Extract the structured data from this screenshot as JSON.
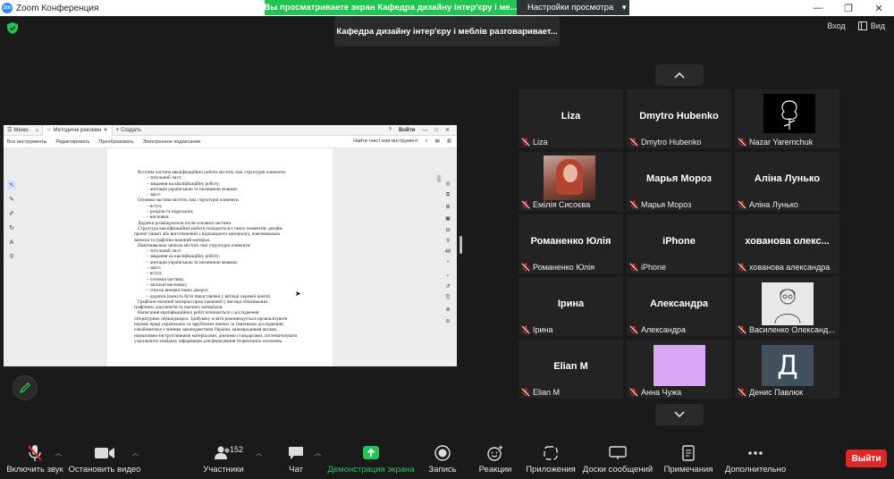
{
  "window": {
    "app_icon_text": "zm",
    "title": "Zoom Конференция",
    "controls": [
      "—",
      "❐",
      "✕"
    ]
  },
  "share_banner": {
    "text": "Вы просматриваете экран Кафедра дизайну інтер'єру і ме...",
    "view_settings": "Настройки просмотра"
  },
  "speaker_tip": "Кафедра дизайну інтер'єру і меблів разговаривает...",
  "top_right": {
    "enter_label": "Вход",
    "view_label": "Вид"
  },
  "shared_doc": {
    "tabs": [
      "Меню",
      "Методичні рекомен",
      "Создать"
    ],
    "login_label": "Войти",
    "menu_items": [
      "Все инструменты",
      "Редактировать",
      "Преобразовать",
      "Электронное подписание"
    ],
    "search_label": "Найти текст или инструмент",
    "page_number": "9",
    "page_total": "46",
    "lines": [
      {
        "text": "Вступна частина кваліфікаційної роботи містить такі структурні елементи:",
        "indent": 0
      },
      {
        "text": "–    титульний лист;",
        "indent": 1
      },
      {
        "text": "–    завдання на кваліфікаційну роботу;",
        "indent": 1
      },
      {
        "text": "–    анотація українською та іноземною мовами;",
        "indent": 1
      },
      {
        "text": "–    зміст.",
        "indent": 1
      },
      {
        "text": "Основна частина містить такі структурні елементи:",
        "indent": 0
      },
      {
        "text": "–    вступ;",
        "indent": 1
      },
      {
        "text": "–    розділи та підрозділи;",
        "indent": 1
      },
      {
        "text": "–    висновки.",
        "indent": 1
      },
      {
        "text": "Додатки розміщуються після основної частини.",
        "indent": 0
      },
      {
        "text": "Структура кваліфікаційної роботи складається з таких елементів: дизайн-",
        "indent": 0
      },
      {
        "text": "проект (макет або виготовлений у відповідного матеріалу), пояснювальна",
        "indent": -1
      },
      {
        "text": "записка та графічно-наочний матеріал.",
        "indent": -1
      },
      {
        "text": "Пояснювальна записка містить такі структурні елементи:",
        "indent": 0
      },
      {
        "text": "–    титульний лист;",
        "indent": 1
      },
      {
        "text": "–    завдання на кваліфікаційну роботу;",
        "indent": 1
      },
      {
        "text": "–    анотація українською та іноземною мовами;",
        "indent": 1
      },
      {
        "text": "–    зміст;",
        "indent": 1
      },
      {
        "text": "–    вступ;",
        "indent": 1
      },
      {
        "text": "–    основна частина;",
        "indent": 1
      },
      {
        "text": "–    загальні висновки;",
        "indent": 1
      },
      {
        "text": "–    список використаних джерел;",
        "indent": 1
      },
      {
        "text": "–    додатки (можуть бути представлені у вигляді окремої книги).",
        "indent": 1
      },
      {
        "text": "Графічно-наочний матеріал представлений у вигляді обов'язкових",
        "indent": 0
      },
      {
        "text": "графічних документів та наочних матеріалів.",
        "indent": -1
      },
      {
        "text": "Написання кваліфікаційних робіт починається з дослідження",
        "indent": 0
      },
      {
        "text": "літературних першоджерел. Здобувачу освіти рекомендується проаналізувати",
        "indent": -1
      },
      {
        "text": "наукові праці українських та зарубіжних вчених за тематикою дослідження,",
        "indent": -1
      },
      {
        "text": "ознайомитися з чинним законодавством України, міжнародними актами,",
        "indent": -1
      },
      {
        "text": "нормативно-інструктивними матеріалами, діючими стандартами, систематизувати",
        "indent": -1
      },
      {
        "text": "узагальнити знайдену інформацію для формування теоретичних положень.",
        "indent": -1
      }
    ]
  },
  "gallery": {
    "participants": [
      {
        "big": "Liza",
        "name": "Liza",
        "kind": "name"
      },
      {
        "big": "Dmytro Hubenko",
        "name": "Dmytro Hubenko",
        "kind": "name"
      },
      {
        "big": "",
        "name": "Nazar Yaremchuk",
        "kind": "nazar"
      },
      {
        "big": "",
        "name": "Емілія Сисоєва",
        "kind": "photo"
      },
      {
        "big": "Марья Мороз",
        "name": "Марья Мороз",
        "kind": "name"
      },
      {
        "big": "Аліна Лунько",
        "name": "Аліна Лунько",
        "kind": "name"
      },
      {
        "big": "Романенко Юлія",
        "name": "Романенко Юлія",
        "kind": "name"
      },
      {
        "big": "iPhone",
        "name": "iPhone",
        "kind": "name"
      },
      {
        "big": "хованова  олекс...",
        "name": "хованова александра",
        "kind": "name"
      },
      {
        "big": "Ірина",
        "name": "Ірина",
        "kind": "name"
      },
      {
        "big": "Александра",
        "name": "Александра",
        "kind": "name"
      },
      {
        "big": "",
        "name": "Василенко Олександ...",
        "kind": "sketch"
      },
      {
        "big": "Elian M",
        "name": "Elian M",
        "kind": "name"
      },
      {
        "big": "",
        "name": "Анна Чужа",
        "kind": "anna"
      },
      {
        "big": "",
        "name": "Денис Павлюк",
        "kind": "d",
        "letter": "Д"
      }
    ]
  },
  "toolbar": {
    "mute": "Включить звук",
    "video": "Остановить видео",
    "participants": "Участники",
    "participants_count": "152",
    "chat": "Чат",
    "share": "Демонстрация экрана",
    "record": "Запись",
    "reactions": "Реакции",
    "apps": "Приложения",
    "whiteboards": "Доски сообщений",
    "notes": "Примечания",
    "more": "Дополнительно",
    "leave": "Выйти"
  },
  "colors": {
    "share_green": "#23c552",
    "leave_red": "#e02828",
    "mic_muted_red": "#e02828",
    "tile_bg": "#232323",
    "app_bg": "#1a1a1a"
  }
}
